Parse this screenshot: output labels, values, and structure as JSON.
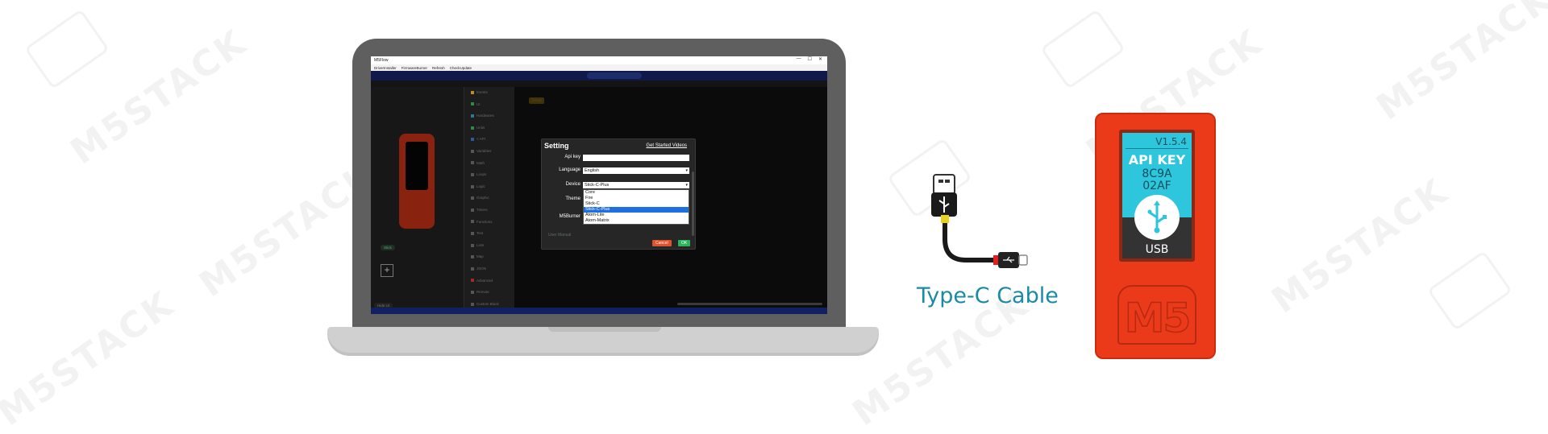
{
  "watermark": {
    "text": "M5STACK"
  },
  "window": {
    "title": "M5Flow",
    "controls": [
      "—",
      "☐",
      "✕"
    ],
    "menu": [
      "DriverInstaller",
      "FirmwareBurner",
      "Refresh",
      "CheckUpdate"
    ]
  },
  "ide": {
    "blocks": [
      {
        "label": "Events",
        "color": "#c78a1c"
      },
      {
        "label": "UI",
        "color": "#2a8a4a"
      },
      {
        "label": "Hardwares",
        "color": "#2a7a8a"
      },
      {
        "label": "Units",
        "color": "#2a8a4a"
      },
      {
        "label": "< API",
        "color": "#2a5a9a"
      },
      {
        "label": "Variables",
        "color": "#555555"
      },
      {
        "label": "Math",
        "color": "#555555"
      },
      {
        "label": "Loops",
        "color": "#555555"
      },
      {
        "label": "Logic",
        "color": "#555555"
      },
      {
        "label": "Graphic",
        "color": "#555555"
      },
      {
        "label": "Timers",
        "color": "#555555"
      },
      {
        "label": "Functions",
        "color": "#555555"
      },
      {
        "label": "Text",
        "color": "#555555"
      },
      {
        "label": "Lists",
        "color": "#555555"
      },
      {
        "label": "Map",
        "color": "#555555"
      },
      {
        "label": "JSON",
        "color": "#555555"
      },
      {
        "label": "Advanced",
        "color": "#a02a2a"
      },
      {
        "label": "Remote",
        "color": "#555555"
      },
      {
        "label": "Custom Block",
        "color": "#555555"
      }
    ],
    "canvas_tag": "Setup",
    "panel_chip": "Stick",
    "panel_footer": "Hide UI"
  },
  "dialog": {
    "title": "Setting",
    "link": "Get Started Videos",
    "api_key": {
      "label": "Api key",
      "value": ""
    },
    "language": {
      "label": "Language",
      "value": "English"
    },
    "device": {
      "label": "Device",
      "value": "Stick-C-Plus",
      "options": [
        "Core",
        "Fire",
        "Stick-C",
        "Stick-C-Plus",
        "Atom-Lite",
        "Atom-Matrix"
      ],
      "selected_index": 3
    },
    "theme": {
      "label": "Theme"
    },
    "burner": {
      "label": "M5Burner"
    },
    "faded_row": "User Manual",
    "cancel": "Cancel",
    "ok": "OK"
  },
  "cable": {
    "caption": "Type-C Cable"
  },
  "stick": {
    "version": "V1.5.4",
    "api_label": "API KEY",
    "key_lines": [
      "8C9A",
      "02AF"
    ],
    "usb_label": "USB",
    "logo": "M5",
    "accent": "#ea3a1a",
    "lcd_color": "#2ec6dc"
  }
}
